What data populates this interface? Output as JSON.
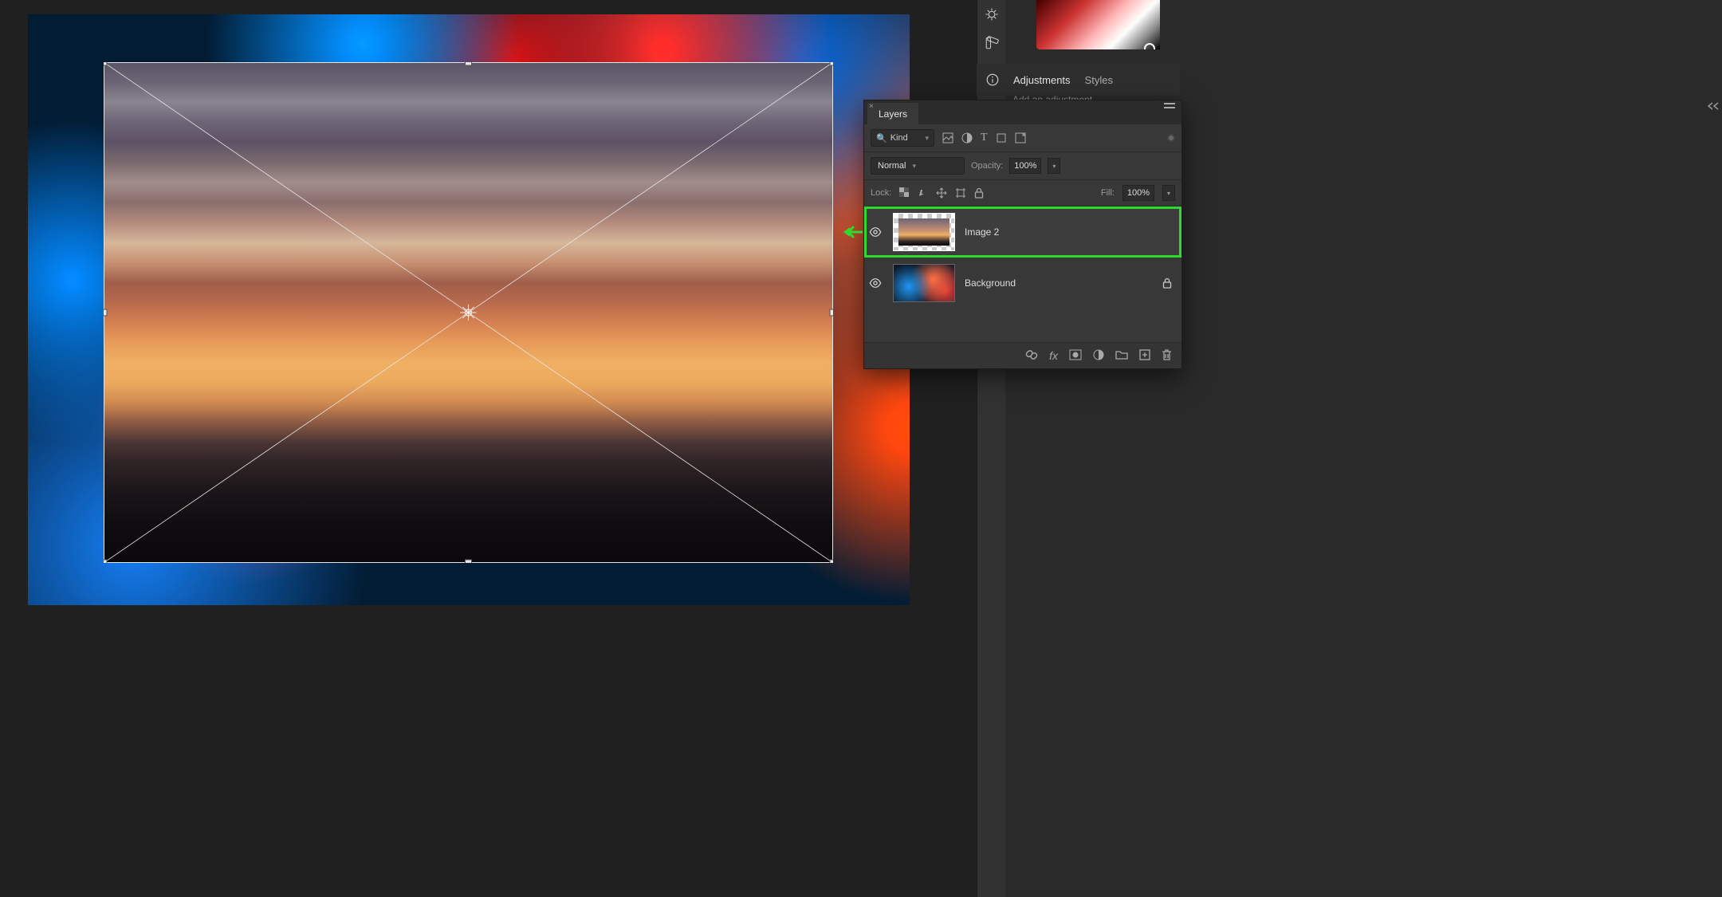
{
  "tabs": {
    "adjustments": "Adjustments",
    "styles": "Styles"
  },
  "add_adjustment_hint": "Add an adjustment",
  "layers_panel": {
    "title": "Layers",
    "filter_kind_label": "Kind",
    "blend_mode": "Normal",
    "opacity_label": "Opacity:",
    "opacity_value": "100%",
    "lock_label": "Lock:",
    "fill_label": "Fill:",
    "fill_value": "100%",
    "layers": [
      {
        "name": "Image 2",
        "visible": true,
        "locked": false,
        "selected": true
      },
      {
        "name": "Background",
        "visible": true,
        "locked": true,
        "selected": false
      }
    ]
  },
  "icons": {
    "search": "🔍",
    "eye": "👁"
  }
}
